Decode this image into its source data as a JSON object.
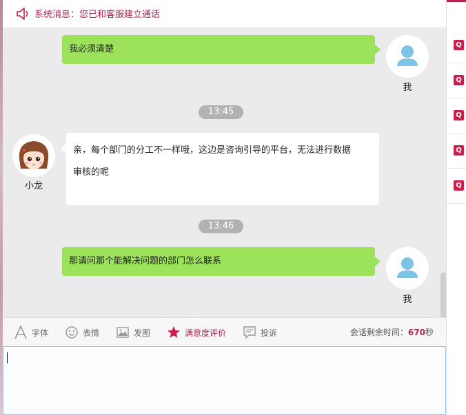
{
  "system_bar": {
    "message": "系统消息：您已和客服建立通话",
    "icon": "speaker-icon"
  },
  "messages": [
    {
      "side": "right",
      "text": "我必须清楚",
      "sender": "我"
    },
    {
      "type": "time",
      "text": "13:45"
    },
    {
      "side": "left",
      "text_line1": "亲，每个部门的分工不一样哦，这边是咨询引导的平台，无法进行数据",
      "text_line2": "审核的呢",
      "sender": "小龙"
    },
    {
      "type": "time",
      "text": "13:46"
    },
    {
      "side": "right",
      "text": "那请问那个能解决问题的部门怎么联系",
      "sender": "我"
    }
  ],
  "toolbar": {
    "font_label": "字体",
    "emoji_label": "表情",
    "image_label": "发图",
    "rating_label": "满意度评价",
    "complaint_label": "投诉",
    "remaining_prefix": "会话剩余时间：",
    "remaining_value": "670",
    "remaining_suffix": "秒"
  },
  "right_panel": {
    "items": [
      "Q",
      "Q",
      "Q",
      "Q",
      "Q"
    ]
  },
  "colors": {
    "accent": "#b5214f",
    "user_bubble": "#9de25b",
    "agent_bubble": "#ffffff",
    "time_pill": "#b2b2b2"
  }
}
